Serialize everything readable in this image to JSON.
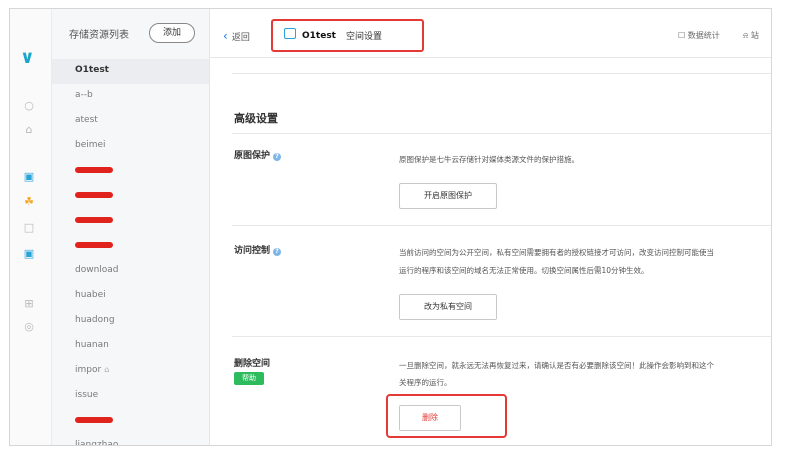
{
  "sidebar": {
    "title": "存储资源列表",
    "add_label": "添加",
    "items": [
      {
        "label": "O1test",
        "active": true,
        "redacted": false
      },
      {
        "label": "a--b",
        "active": false,
        "redacted": false
      },
      {
        "label": "atest",
        "active": false,
        "redacted": false
      },
      {
        "label": "beimei",
        "active": false,
        "redacted": false
      },
      {
        "label": "",
        "active": false,
        "redacted": true
      },
      {
        "label": "",
        "active": false,
        "redacted": true
      },
      {
        "label": "",
        "active": false,
        "redacted": true
      },
      {
        "label": "",
        "active": false,
        "redacted": true
      },
      {
        "label": "download",
        "active": false,
        "redacted": false
      },
      {
        "label": "huabei",
        "active": false,
        "redacted": false
      },
      {
        "label": "huadong",
        "active": false,
        "redacted": false
      },
      {
        "label": "huanan",
        "active": false,
        "redacted": false
      },
      {
        "label": "impor",
        "active": false,
        "redacted": false,
        "locked": true
      },
      {
        "label": "issue",
        "active": false,
        "redacted": false
      },
      {
        "label": "",
        "active": false,
        "redacted": true
      },
      {
        "label": "liangzhao",
        "active": false,
        "redacted": false
      }
    ]
  },
  "header": {
    "back_label": "返回",
    "bucket_name": "O1test",
    "tab_label": "空间设置",
    "stats_label": "数据统计",
    "notif_label": "站"
  },
  "advanced": {
    "title": "高级设置",
    "protection": {
      "label": "原图保护",
      "desc": "原图保护是七牛云存储针对媒体类源文件的保护措施。",
      "button": "开启原图保护"
    },
    "access": {
      "label": "访问控制",
      "desc_line1": "当前访问的空间为公开空间，私有空间需要拥有者的授权链接才可访问，改变访问控制可能使当",
      "desc_line2": "运行的程序和该空间的域名无法正常使用。切换空间属性后需10分钟生效。",
      "button": "改为私有空间"
    },
    "delete": {
      "label": "删除空间",
      "help_badge": "帮助",
      "desc_line1": "一旦删除空间，就永远无法再恢复过来，请确认是否有必要删除该空间！此操作会影响到和这个",
      "desc_line2": "关程序的运行。",
      "button": "删除"
    }
  },
  "colors": {
    "highlight": "#e53935",
    "accent": "#1aa6c9",
    "help_badge": "#2dbb5d",
    "redaction": "#e0241d"
  }
}
